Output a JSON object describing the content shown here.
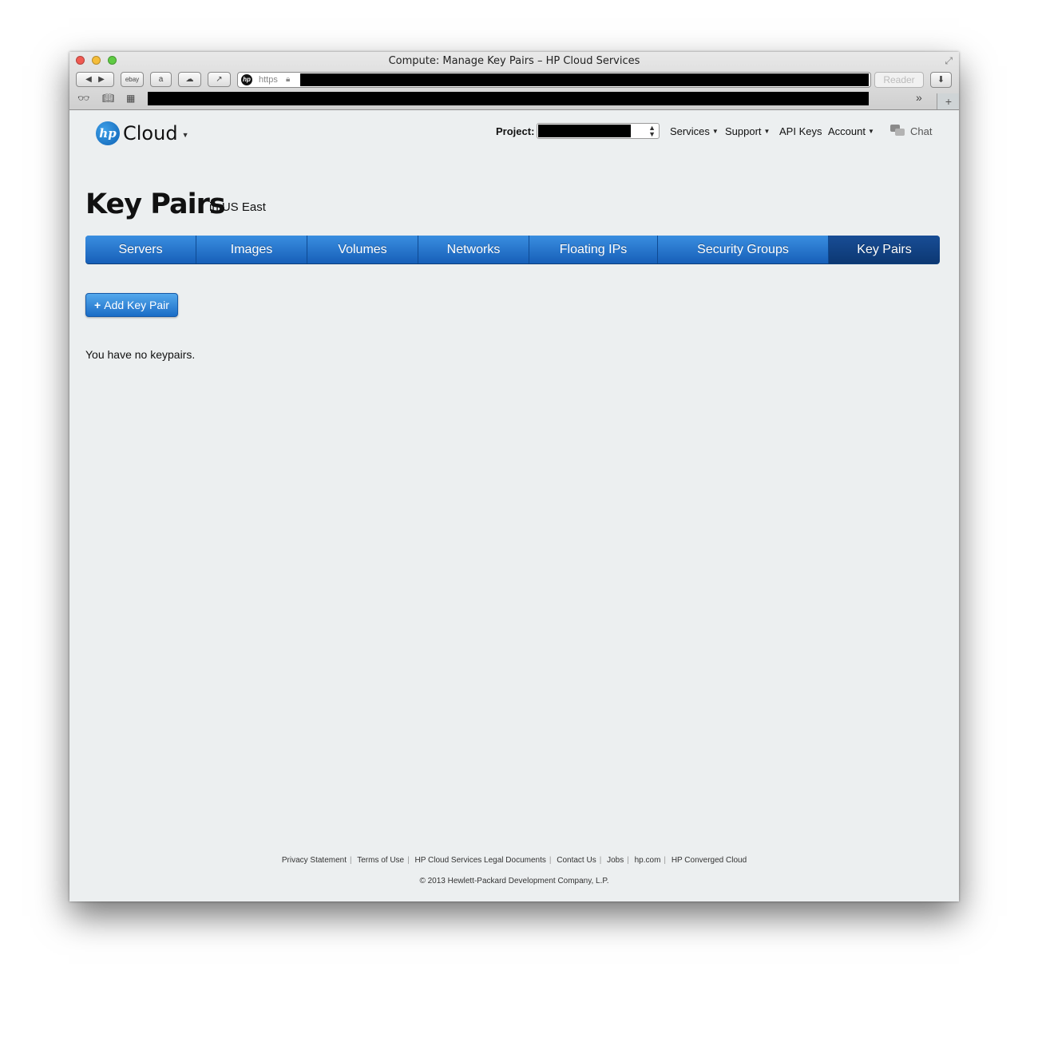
{
  "browser": {
    "window_title": "Compute: Manage Key Pairs – HP Cloud Services",
    "url_scheme": "https",
    "reader_label": "Reader",
    "bookmark_ebay": "ebay"
  },
  "header": {
    "logo_text": "Cloud",
    "logo_mark": "hp",
    "project_label": "Project:",
    "nav": {
      "services": "Services",
      "support": "Support",
      "api_keys": "API Keys",
      "account": "Account",
      "chat": "Chat"
    }
  },
  "main": {
    "title": "Key Pairs",
    "region": "in US East",
    "tabs": [
      {
        "label": "Servers",
        "active": false
      },
      {
        "label": "Images",
        "active": false
      },
      {
        "label": "Volumes",
        "active": false
      },
      {
        "label": "Networks",
        "active": false
      },
      {
        "label": "Floating IPs",
        "active": false
      },
      {
        "label": "Security Groups",
        "active": false
      },
      {
        "label": "Key Pairs",
        "active": true
      }
    ],
    "add_button_label": "Add Key Pair",
    "empty_message": "You have no keypairs."
  },
  "footer": {
    "links": [
      "Privacy Statement",
      "Terms of Use",
      "HP Cloud Services Legal Documents",
      "Contact Us",
      "Jobs",
      "hp.com",
      "HP Converged Cloud"
    ],
    "copyright": "© 2013 Hewlett-Packard Development Company, L.P."
  },
  "colors": {
    "tab_blue": "#1f6fc7",
    "tab_active": "#0c3873",
    "page_bg": "#eceff0"
  }
}
